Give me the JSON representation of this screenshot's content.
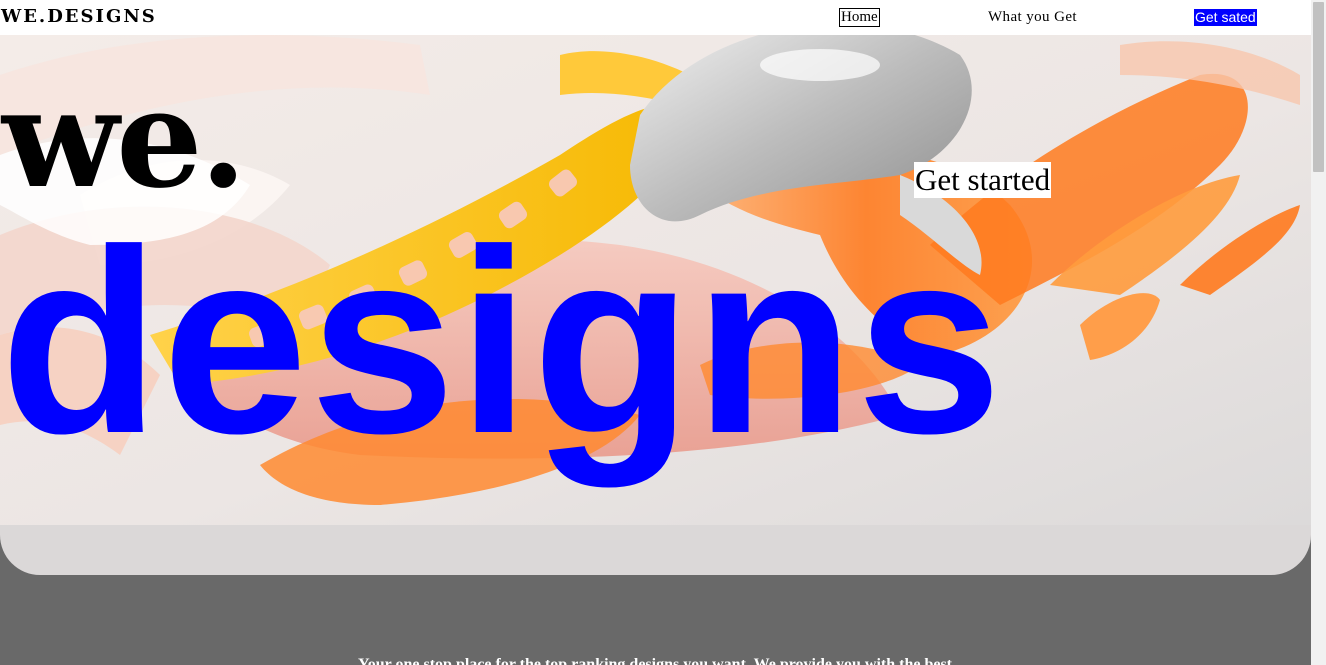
{
  "nav": {
    "brand": "WE.DESIGNS",
    "links": [
      {
        "label": "Home"
      },
      {
        "label": "What you Get"
      },
      {
        "label": "Get sated"
      }
    ]
  },
  "hero": {
    "word_top": "we.",
    "word_bottom": "designs",
    "cta_label": "Get started",
    "accent_color": "#0000ff"
  },
  "content": {
    "intro_text": "Your one stop place for the top ranking designs you want. We provide you with the best"
  }
}
